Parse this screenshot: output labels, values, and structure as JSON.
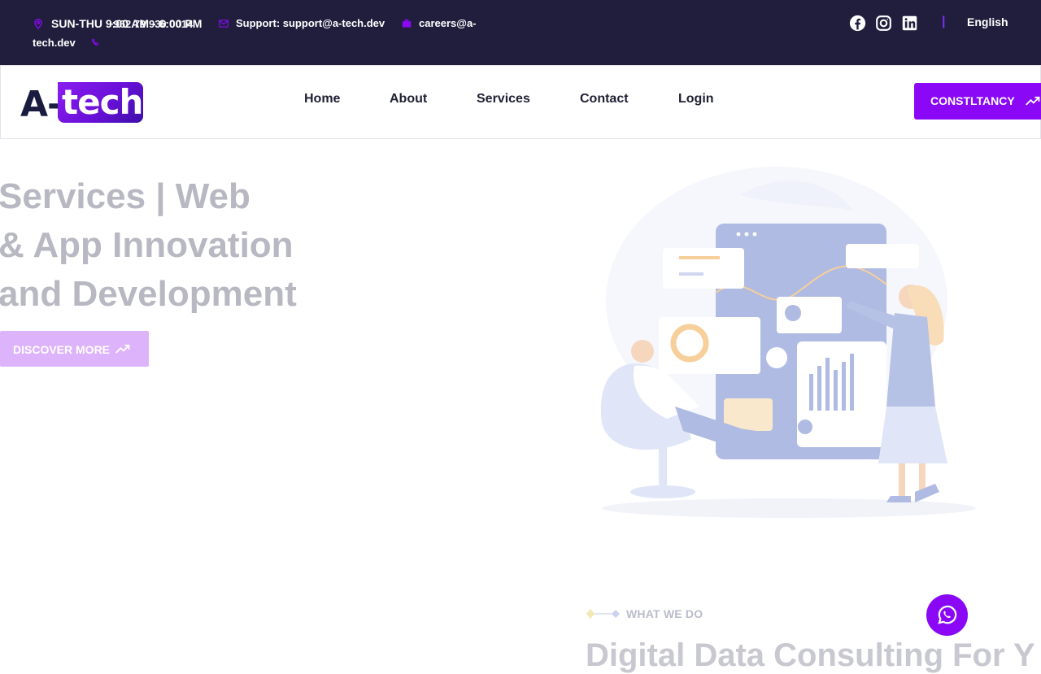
{
  "topbar": {
    "hours": "SUN-THU 9:00 AM - 6:00 PM",
    "phone": "+962 79 930 0014",
    "support": "Support: support@a-tech.dev",
    "careers_line1": "careers@a-",
    "careers_line2": "tech.dev",
    "language": "English",
    "separator": "|",
    "social_icons": [
      "facebook-icon",
      "instagram-icon",
      "linkedin-icon"
    ]
  },
  "nav": {
    "logo_left": "A-",
    "logo_right": "tech",
    "links": [
      "Home",
      "About",
      "Services",
      "Contact",
      "Login"
    ],
    "cta_label": "CONSTLTANCY"
  },
  "hero": {
    "title_lines": [
      "Services | Web",
      "& App Innovation",
      "and Development"
    ],
    "button_label": "DISCOVER MORE"
  },
  "section": {
    "eyebrow": "WHAT WE DO",
    "title": "Digital Data Consulting For Y"
  },
  "colors": {
    "topbar_bg": "#201e3c",
    "accent": "#8a08f5",
    "hero_text": "#b8b8c2"
  }
}
